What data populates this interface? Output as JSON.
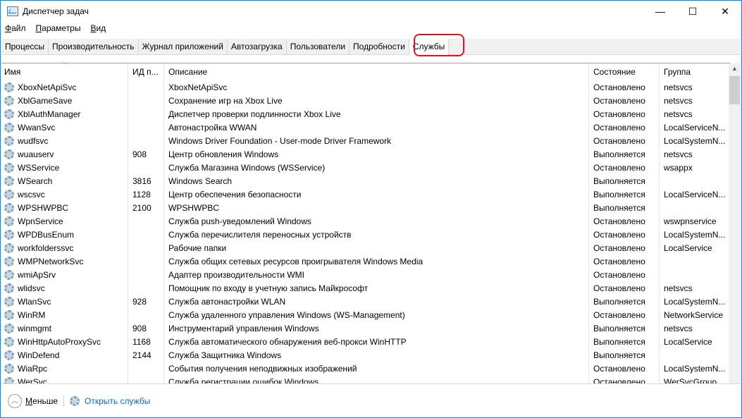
{
  "window": {
    "title": "Диспетчер задач",
    "minimize": "—",
    "maximize": "☐",
    "close": "✕"
  },
  "menu": [
    "Файл",
    "Параметры",
    "Вид"
  ],
  "tabs": [
    "Процессы",
    "Производительность",
    "Журнал приложений",
    "Автозагрузка",
    "Пользователи",
    "Подробности",
    "Службы"
  ],
  "active_tab": "Службы",
  "columns": [
    "Имя",
    "ИД п...",
    "Описание",
    "Состояние",
    "Группа"
  ],
  "rows": [
    [
      "XboxNetApiSvc",
      "",
      "XboxNetApiSvc",
      "Остановлено",
      "netsvcs"
    ],
    [
      "XblGameSave",
      "",
      "Сохранение игр на Xbox Live",
      "Остановлено",
      "netsvcs"
    ],
    [
      "XblAuthManager",
      "",
      "Диспетчер проверки подлинности Xbox Live",
      "Остановлено",
      "netsvcs"
    ],
    [
      "WwanSvc",
      "",
      "Автонастройка WWAN",
      "Остановлено",
      "LocalServiceN..."
    ],
    [
      "wudfsvc",
      "",
      "Windows Driver Foundation - User-mode Driver Framework",
      "Остановлено",
      "LocalSystemN..."
    ],
    [
      "wuauserv",
      "908",
      "Центр обновления Windows",
      "Выполняется",
      "netsvcs"
    ],
    [
      "WSService",
      "",
      "Служба Магазина Windows (WSService)",
      "Остановлено",
      "wsappx"
    ],
    [
      "WSearch",
      "3816",
      "Windows Search",
      "Выполняется",
      ""
    ],
    [
      "wscsvc",
      "1128",
      "Центр обеспечения безопасности",
      "Выполняется",
      "LocalServiceN..."
    ],
    [
      "WPSHWPBC",
      "2100",
      "WPSHWPBC",
      "Выполняется",
      ""
    ],
    [
      "WpnService",
      "",
      "Служба push-уведомлений Windows",
      "Остановлено",
      "wswpnservice"
    ],
    [
      "WPDBusEnum",
      "",
      "Служба перечислителя переносных устройств",
      "Остановлено",
      "LocalSystemN..."
    ],
    [
      "workfolderssvc",
      "",
      "Рабочие папки",
      "Остановлено",
      "LocalService"
    ],
    [
      "WMPNetworkSvc",
      "",
      "Служба общих сетевых ресурсов проигрывателя Windows Media",
      "Остановлено",
      ""
    ],
    [
      "wmiApSrv",
      "",
      "Адаптер производительности WMI",
      "Остановлено",
      ""
    ],
    [
      "wlidsvc",
      "",
      "Помощник по входу в учетную запись Майкрософт",
      "Остановлено",
      "netsvcs"
    ],
    [
      "WlanSvc",
      "928",
      "Служба автонастройки WLAN",
      "Выполняется",
      "LocalSystemN..."
    ],
    [
      "WinRM",
      "",
      "Служба удаленного управления Windows (WS-Management)",
      "Остановлено",
      "NetworkService"
    ],
    [
      "winmgmt",
      "908",
      "Инструментарий управления Windows",
      "Выполняется",
      "netsvcs"
    ],
    [
      "WinHttpAutoProxySvc",
      "1168",
      "Служба автоматического обнаружения веб-прокси WinHTTP",
      "Выполняется",
      "LocalService"
    ],
    [
      "WinDefend",
      "2144",
      "Служба Защитника Windows",
      "Выполняется",
      ""
    ],
    [
      "WiaRpc",
      "",
      "События получения неподвижных изображений",
      "Остановлено",
      "LocalSystemN..."
    ],
    [
      "WerSvc",
      "",
      "Служба регистрации ошибок Windows",
      "Остановлено",
      "WerSvcGroup"
    ]
  ],
  "footer": {
    "less": "Меньше",
    "open_services": "Открыть службы"
  }
}
